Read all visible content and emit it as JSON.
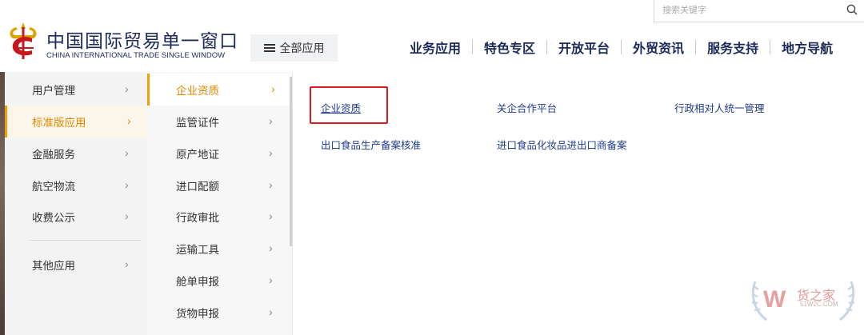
{
  "brand": {
    "name_cn": "中国国际贸易单一窗口",
    "name_en": "CHINA INTERNATIONAL TRADE SINGLE WINDOW"
  },
  "header": {
    "all_apps_label": "全部应用",
    "search_placeholder": "搜索关键字",
    "nav": [
      "业务应用",
      "特色专区",
      "开放平台",
      "外贸资讯",
      "服务支持",
      "地方导航"
    ]
  },
  "menu": {
    "level1": [
      {
        "label": "用户管理",
        "active": false
      },
      {
        "label": "标准版应用",
        "active": true
      },
      {
        "label": "金融服务",
        "active": false
      },
      {
        "label": "航空物流",
        "active": false
      },
      {
        "label": "收费公示",
        "active": false
      },
      {
        "label": "其他应用",
        "active": false
      }
    ],
    "level2": [
      {
        "label": "企业资质",
        "active": true
      },
      {
        "label": "监管证件",
        "active": false
      },
      {
        "label": "原产地证",
        "active": false
      },
      {
        "label": "进口配额",
        "active": false
      },
      {
        "label": "行政审批",
        "active": false
      },
      {
        "label": "运输工具",
        "active": false
      },
      {
        "label": "舱单申报",
        "active": false
      },
      {
        "label": "货物申报",
        "active": false
      }
    ],
    "arrow": "›",
    "links": [
      "企业资质",
      "关企合作平台",
      "行政相对人统一管理",
      "出口食品生产备案核准",
      "进口食品化妆品进出口商备案"
    ]
  },
  "watermark": {
    "text": "货之家",
    "sub": "51W2C.COM",
    "letter": "W"
  },
  "colors": {
    "accent": "#f0a000",
    "active_text": "#e08a00",
    "brand_navy": "#1c2a5a",
    "link_blue": "#1e3c8c",
    "highlight_red": "#e0191e"
  }
}
